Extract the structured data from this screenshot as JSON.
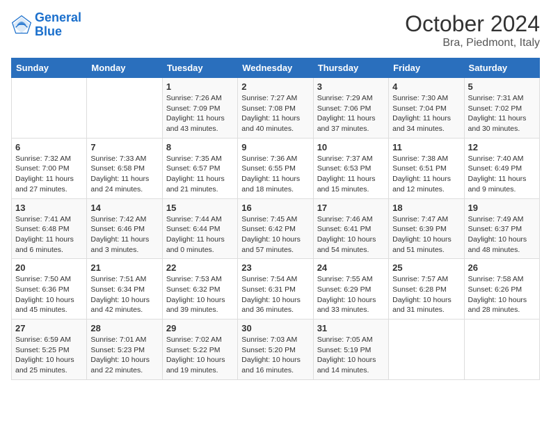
{
  "header": {
    "logo_line1": "General",
    "logo_line2": "Blue",
    "month_title": "October 2024",
    "location": "Bra, Piedmont, Italy"
  },
  "weekdays": [
    "Sunday",
    "Monday",
    "Tuesday",
    "Wednesday",
    "Thursday",
    "Friday",
    "Saturday"
  ],
  "weeks": [
    [
      {
        "day": "",
        "text": ""
      },
      {
        "day": "",
        "text": ""
      },
      {
        "day": "1",
        "text": "Sunrise: 7:26 AM\nSunset: 7:09 PM\nDaylight: 11 hours and 43 minutes."
      },
      {
        "day": "2",
        "text": "Sunrise: 7:27 AM\nSunset: 7:08 PM\nDaylight: 11 hours and 40 minutes."
      },
      {
        "day": "3",
        "text": "Sunrise: 7:29 AM\nSunset: 7:06 PM\nDaylight: 11 hours and 37 minutes."
      },
      {
        "day": "4",
        "text": "Sunrise: 7:30 AM\nSunset: 7:04 PM\nDaylight: 11 hours and 34 minutes."
      },
      {
        "day": "5",
        "text": "Sunrise: 7:31 AM\nSunset: 7:02 PM\nDaylight: 11 hours and 30 minutes."
      }
    ],
    [
      {
        "day": "6",
        "text": "Sunrise: 7:32 AM\nSunset: 7:00 PM\nDaylight: 11 hours and 27 minutes."
      },
      {
        "day": "7",
        "text": "Sunrise: 7:33 AM\nSunset: 6:58 PM\nDaylight: 11 hours and 24 minutes."
      },
      {
        "day": "8",
        "text": "Sunrise: 7:35 AM\nSunset: 6:57 PM\nDaylight: 11 hours and 21 minutes."
      },
      {
        "day": "9",
        "text": "Sunrise: 7:36 AM\nSunset: 6:55 PM\nDaylight: 11 hours and 18 minutes."
      },
      {
        "day": "10",
        "text": "Sunrise: 7:37 AM\nSunset: 6:53 PM\nDaylight: 11 hours and 15 minutes."
      },
      {
        "day": "11",
        "text": "Sunrise: 7:38 AM\nSunset: 6:51 PM\nDaylight: 11 hours and 12 minutes."
      },
      {
        "day": "12",
        "text": "Sunrise: 7:40 AM\nSunset: 6:49 PM\nDaylight: 11 hours and 9 minutes."
      }
    ],
    [
      {
        "day": "13",
        "text": "Sunrise: 7:41 AM\nSunset: 6:48 PM\nDaylight: 11 hours and 6 minutes."
      },
      {
        "day": "14",
        "text": "Sunrise: 7:42 AM\nSunset: 6:46 PM\nDaylight: 11 hours and 3 minutes."
      },
      {
        "day": "15",
        "text": "Sunrise: 7:44 AM\nSunset: 6:44 PM\nDaylight: 11 hours and 0 minutes."
      },
      {
        "day": "16",
        "text": "Sunrise: 7:45 AM\nSunset: 6:42 PM\nDaylight: 10 hours and 57 minutes."
      },
      {
        "day": "17",
        "text": "Sunrise: 7:46 AM\nSunset: 6:41 PM\nDaylight: 10 hours and 54 minutes."
      },
      {
        "day": "18",
        "text": "Sunrise: 7:47 AM\nSunset: 6:39 PM\nDaylight: 10 hours and 51 minutes."
      },
      {
        "day": "19",
        "text": "Sunrise: 7:49 AM\nSunset: 6:37 PM\nDaylight: 10 hours and 48 minutes."
      }
    ],
    [
      {
        "day": "20",
        "text": "Sunrise: 7:50 AM\nSunset: 6:36 PM\nDaylight: 10 hours and 45 minutes."
      },
      {
        "day": "21",
        "text": "Sunrise: 7:51 AM\nSunset: 6:34 PM\nDaylight: 10 hours and 42 minutes."
      },
      {
        "day": "22",
        "text": "Sunrise: 7:53 AM\nSunset: 6:32 PM\nDaylight: 10 hours and 39 minutes."
      },
      {
        "day": "23",
        "text": "Sunrise: 7:54 AM\nSunset: 6:31 PM\nDaylight: 10 hours and 36 minutes."
      },
      {
        "day": "24",
        "text": "Sunrise: 7:55 AM\nSunset: 6:29 PM\nDaylight: 10 hours and 33 minutes."
      },
      {
        "day": "25",
        "text": "Sunrise: 7:57 AM\nSunset: 6:28 PM\nDaylight: 10 hours and 31 minutes."
      },
      {
        "day": "26",
        "text": "Sunrise: 7:58 AM\nSunset: 6:26 PM\nDaylight: 10 hours and 28 minutes."
      }
    ],
    [
      {
        "day": "27",
        "text": "Sunrise: 6:59 AM\nSunset: 5:25 PM\nDaylight: 10 hours and 25 minutes."
      },
      {
        "day": "28",
        "text": "Sunrise: 7:01 AM\nSunset: 5:23 PM\nDaylight: 10 hours and 22 minutes."
      },
      {
        "day": "29",
        "text": "Sunrise: 7:02 AM\nSunset: 5:22 PM\nDaylight: 10 hours and 19 minutes."
      },
      {
        "day": "30",
        "text": "Sunrise: 7:03 AM\nSunset: 5:20 PM\nDaylight: 10 hours and 16 minutes."
      },
      {
        "day": "31",
        "text": "Sunrise: 7:05 AM\nSunset: 5:19 PM\nDaylight: 10 hours and 14 minutes."
      },
      {
        "day": "",
        "text": ""
      },
      {
        "day": "",
        "text": ""
      }
    ]
  ]
}
